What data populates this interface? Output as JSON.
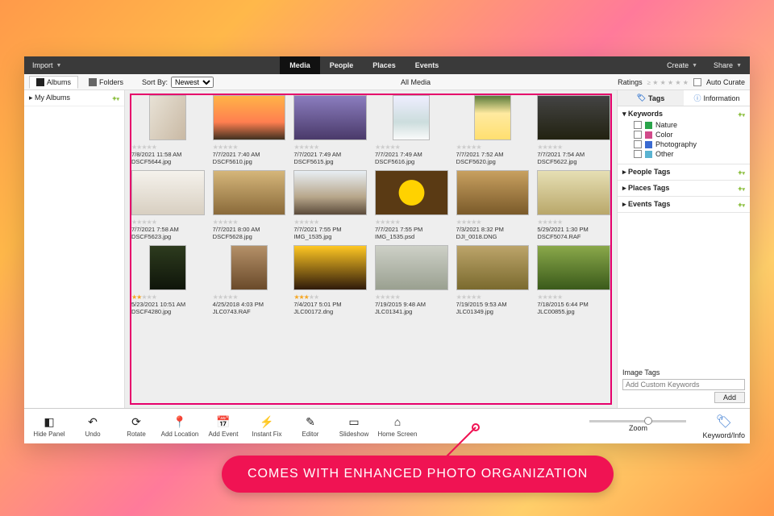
{
  "topbar": {
    "import": "Import",
    "create": "Create",
    "share": "Share",
    "views": [
      {
        "label": "Media",
        "active": true
      },
      {
        "label": "People",
        "active": false
      },
      {
        "label": "Places",
        "active": false
      },
      {
        "label": "Events",
        "active": false
      }
    ]
  },
  "secbar": {
    "albums": "Albums",
    "folders": "Folders",
    "sort_label": "Sort By:",
    "sort_value": "Newest",
    "all_media": "All Media",
    "ratings": "Ratings",
    "auto_curate": "Auto Curate"
  },
  "leftpanel": {
    "my_albums": "My Albums"
  },
  "thumbs": [
    {
      "stars": 0,
      "date": "7/8/2021 11:58 AM",
      "file": "DSCF5644.jpg",
      "cls": "th0",
      "portrait": true
    },
    {
      "stars": 0,
      "date": "7/7/2021 7:40 AM",
      "file": "DSCF5610.jpg",
      "cls": "th1"
    },
    {
      "stars": 0,
      "date": "7/7/2021 7:49 AM",
      "file": "DSCF5615.jpg",
      "cls": "th2"
    },
    {
      "stars": 0,
      "date": "7/7/2021 7:49 AM",
      "file": "DSCF5616.jpg",
      "cls": "th3",
      "portrait": true
    },
    {
      "stars": 0,
      "date": "7/7/2021 7:52 AM",
      "file": "DSCF5620.jpg",
      "cls": "th4",
      "portrait": true
    },
    {
      "stars": 0,
      "date": "7/7/2021 7:54 AM",
      "file": "DSCF5622.jpg",
      "cls": "th5"
    },
    {
      "stars": 0,
      "date": "7/7/2021 7:58 AM",
      "file": "DSCF5623.jpg",
      "cls": "th6"
    },
    {
      "stars": 0,
      "date": "7/7/2021 8:00 AM",
      "file": "DSCF5628.jpg",
      "cls": "th7"
    },
    {
      "stars": 0,
      "date": "7/7/2021 7:55 PM",
      "file": "IMG_1535.jpg",
      "cls": "th8"
    },
    {
      "stars": 0,
      "date": "7/7/2021 7:55 PM",
      "file": "IMG_1535.psd",
      "cls": "th9"
    },
    {
      "stars": 0,
      "date": "7/3/2021 8:32 PM",
      "file": "DJI_0018.DNG",
      "cls": "th10"
    },
    {
      "stars": 0,
      "date": "5/29/2021 1:30 PM",
      "file": "DSCF5074.RAF",
      "cls": "th11"
    },
    {
      "stars": 2,
      "date": "5/23/2021 10:51 AM",
      "file": "DSCF4280.jpg",
      "cls": "th12",
      "portrait": true
    },
    {
      "stars": 0,
      "date": "4/25/2018 4:03 PM",
      "file": "JLC0743.RAF",
      "cls": "th13",
      "portrait": true
    },
    {
      "stars": 3,
      "date": "7/4/2017 5:01 PM",
      "file": "JLC00172.dng",
      "cls": "th14"
    },
    {
      "stars": 0,
      "date": "7/19/2015 9:48 AM",
      "file": "JLC01341.jpg",
      "cls": "th15"
    },
    {
      "stars": 0,
      "date": "7/19/2015 9:53 AM",
      "file": "JLC01349.jpg",
      "cls": "th16"
    },
    {
      "stars": 0,
      "date": "7/18/2015 6:44 PM",
      "file": "JLC00855.jpg",
      "cls": "th17"
    }
  ],
  "rightpanel": {
    "tags_tab": "Tags",
    "info_tab": "Information",
    "keywords_hdr": "Keywords",
    "keywords": [
      {
        "label": "Nature",
        "color": "#2aa34a"
      },
      {
        "label": "Color",
        "color": "#d14a8a"
      },
      {
        "label": "Photography",
        "color": "#3a6ad1"
      },
      {
        "label": "Other",
        "color": "#5ab3d1"
      }
    ],
    "people_tags": "People Tags",
    "places_tags": "Places Tags",
    "events_tags": "Events Tags",
    "image_tags_hdr": "Image Tags",
    "image_tags_placeholder": "Add Custom Keywords",
    "add_button": "Add"
  },
  "bottombar": {
    "buttons": [
      {
        "label": "Hide Panel",
        "icon": "◧",
        "name": "hide-panel-button"
      },
      {
        "label": "Undo",
        "icon": "↶",
        "name": "undo-button"
      },
      {
        "label": "Rotate",
        "icon": "⟳",
        "name": "rotate-button"
      },
      {
        "label": "Add Location",
        "icon": "📍",
        "name": "add-location-button"
      },
      {
        "label": "Add Event",
        "icon": "📅",
        "name": "add-event-button"
      },
      {
        "label": "Instant Fix",
        "icon": "⚡",
        "name": "instant-fix-button"
      },
      {
        "label": "Editor",
        "icon": "✎",
        "name": "editor-button"
      },
      {
        "label": "Slideshow",
        "icon": "▭",
        "name": "slideshow-button"
      },
      {
        "label": "Home Screen",
        "icon": "⌂",
        "name": "home-screen-button"
      }
    ],
    "zoom_label": "Zoom",
    "kwinfo_label": "Keyword/Info"
  },
  "callout": "COMES WITH ENHANCED PHOTO ORGANIZATION"
}
